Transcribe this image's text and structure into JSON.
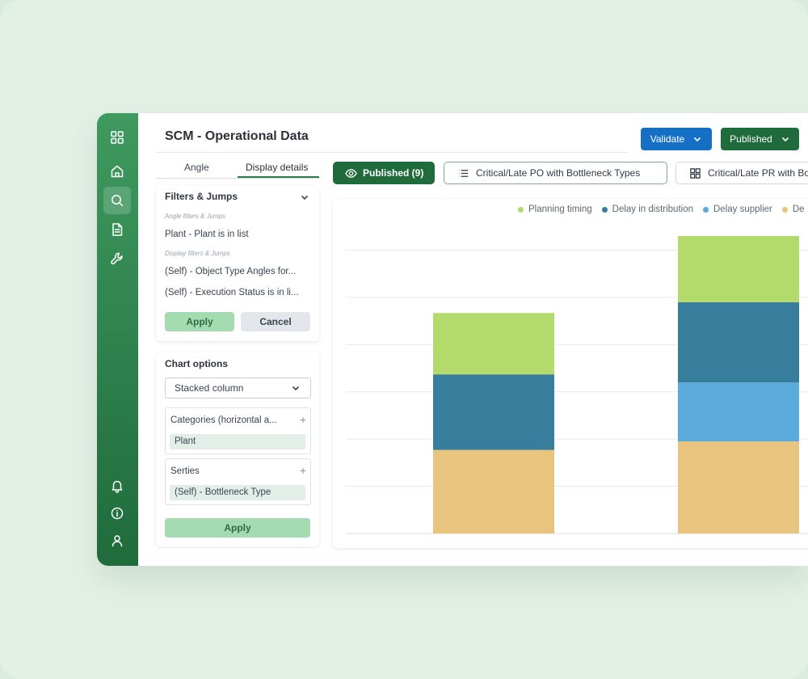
{
  "page": {
    "title": "SCM - Operational Data"
  },
  "header": {
    "validate_label": "Validate",
    "published_label": "Published"
  },
  "rail": {
    "top_icons": [
      "apps-grid-icon",
      "home-icon",
      "search-icon",
      "document-icon",
      "wrench-icon"
    ],
    "bottom_icons": [
      "bell-icon",
      "info-icon",
      "user-icon"
    ],
    "active": "search-icon"
  },
  "left_tabs": {
    "angle": "Angle",
    "display_details": "Display details",
    "active": "Display details"
  },
  "filters": {
    "heading": "Filters & Jumps",
    "angle_caption": "Angle filters & Jumps",
    "angle_rows": [
      "Plant - Plant is in list"
    ],
    "display_caption": "Display filters & Jumps",
    "display_rows": [
      "(Self) - Object Type Angles for...",
      "(Self) - Execution Status is in li..."
    ],
    "apply_label": "Apply",
    "cancel_label": "Cancel"
  },
  "chart_options": {
    "heading": "Chart options",
    "chart_type": "Stacked column",
    "categories_label": "Categories (horizontal a...",
    "categories_value": "Plant",
    "series_label": "Serties",
    "series_value": "(Self) - Bottleneck Type",
    "apply_label": "Apply"
  },
  "toolbar": {
    "published_pill": "Published (9)",
    "display_po": "Critical/Late PO with Bottleneck Types",
    "display_pr": "Critical/Late PR with Bott"
  },
  "chart_data": {
    "type": "bar",
    "stacked": true,
    "title": "",
    "xlabel": "",
    "ylabel": "",
    "categories": [
      "",
      ""
    ],
    "ylim": [
      0,
      6.3
    ],
    "grid": true,
    "legend_position": "top",
    "tick_labels_visible": false,
    "series": [
      {
        "name": "Planning timing",
        "color": "#b2db6b",
        "values": [
          1.3,
          1.4
        ]
      },
      {
        "name": "Delay in distribution",
        "color": "#377e9c",
        "values": [
          1.6,
          1.7
        ]
      },
      {
        "name": "Delay supplier",
        "color": "#5aaadc",
        "values": [
          0,
          1.25
        ]
      },
      {
        "name": "De",
        "color": "#e8c47f",
        "values": [
          1.77,
          1.95
        ]
      }
    ],
    "stack_order_bottom_to_top": [
      "De",
      "Delay supplier",
      "Delay in distribution",
      "Planning timing"
    ]
  }
}
